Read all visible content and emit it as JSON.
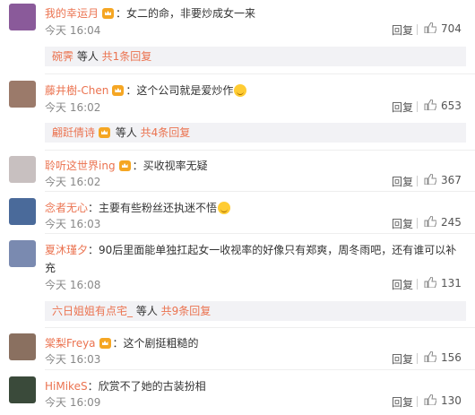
{
  "comments": [
    {
      "username": "我的幸运月",
      "text": "：女二的命，非要炒成女一来",
      "time": "今天 16:04",
      "likes": "704",
      "avatar_color": "#8a5a9a"
    },
    {
      "username": "藤井樹-Chen",
      "text": "：这个公司就是爱炒作",
      "time": "今天 16:02",
      "likes": "653",
      "avatar_color": "#9b7a6a"
    },
    {
      "username": "聆听这世界ing",
      "text": "：买收视率无疑",
      "time": "今天 16:02",
      "likes": "367",
      "avatar_color": "#c8c0c0"
    },
    {
      "username": "念者无心",
      "text": "：主要有些粉丝还执迷不悟",
      "time": "今天 16:03",
      "likes": "245",
      "avatar_color": "#4a6a9a"
    },
    {
      "username": "夏沐瑾夕",
      "text": "：90后里面能单独扛起女一收视率的好像只有郑爽，周冬雨吧，还有谁可以补",
      "text2": "充",
      "time": "今天 16:08",
      "likes": "131",
      "avatar_color": "#7a8ab0"
    },
    {
      "username": "棠梨Freya",
      "text": "：这个剧挺粗糙的",
      "time": "今天 16:03",
      "likes": "156",
      "avatar_color": "#8a7060"
    },
    {
      "username": "HiMikeS",
      "text": "：欣赏不了她的古装扮相",
      "time": "今天 16:09",
      "likes": "130",
      "avatar_color": "#3a4a3a"
    }
  ],
  "replies": [
    {
      "name": "碗霁",
      "mid": " 等人 ",
      "more": "共1条回复"
    },
    {
      "name": "翩跹倩诗",
      "mid": " 等人 ",
      "more": "共4条回复"
    },
    {
      "name": "六日姐姐有点宅_",
      "mid": " 等人 ",
      "more": "共9条回复"
    }
  ],
  "labels": {
    "reply": "回复"
  },
  "colors": {
    "username": "#eb7350",
    "vip_badge": "#f5a623"
  }
}
